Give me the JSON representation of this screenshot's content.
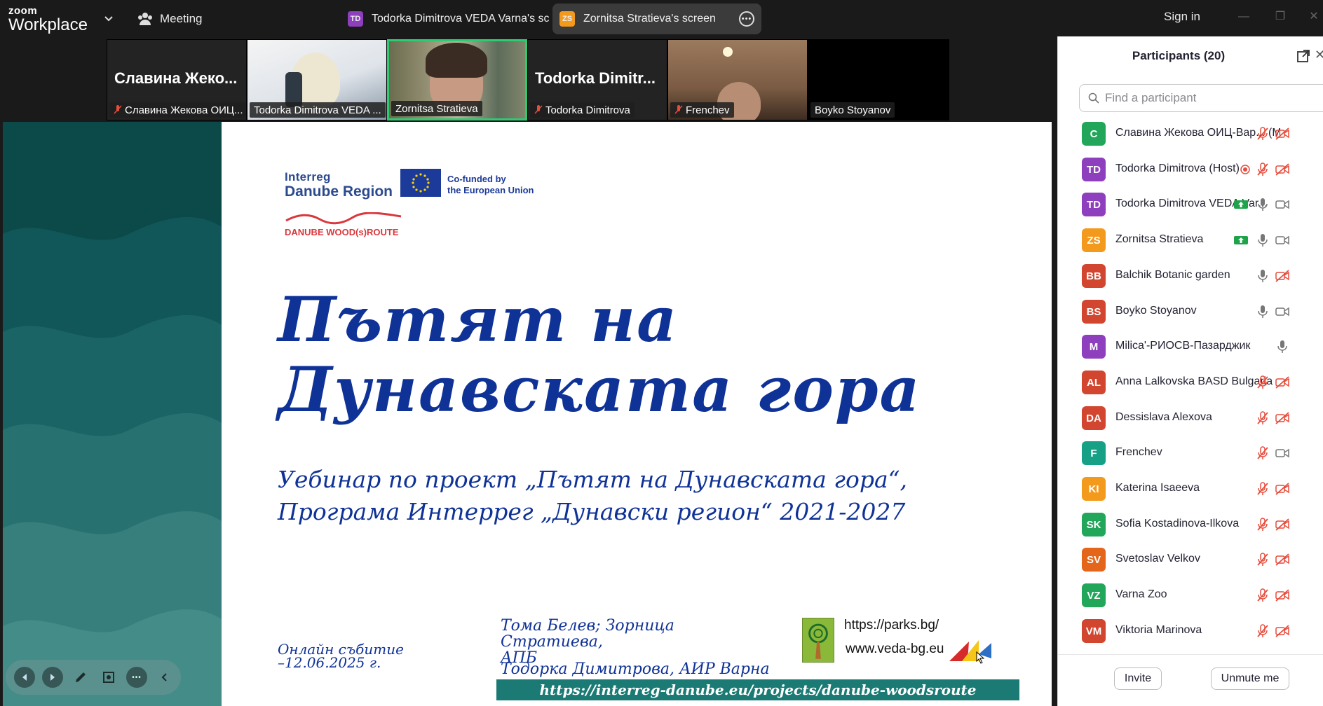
{
  "app": {
    "brand_small": "zoom",
    "brand_big": "Workplace"
  },
  "topbar": {
    "meeting_label": "Meeting",
    "share_tabs": [
      {
        "badge": "TD",
        "label": "Todorka Dimitrova VEDA Varna's scree"
      },
      {
        "badge": "ZS",
        "label": "Zornitsa Stratieva's screen"
      }
    ],
    "signin_label": "Sign in"
  },
  "filmstrip": [
    {
      "big_name": "Славина Жеко...",
      "label": "Славина Жекова ОИЦ..."
    },
    {
      "label": "Todorka Dimitrova VEDA ..."
    },
    {
      "label": "Zornitsa Stratieva"
    },
    {
      "big_name": "Todorka Dimitr...",
      "label": "Todorka Dimitrova"
    },
    {
      "label": "Frenchev"
    },
    {
      "label": "Boyko Stoyanov"
    }
  ],
  "slide": {
    "interreg_line1": "Interreg",
    "interreg_line2": "Danube Region",
    "cofunded_line1": "Co-funded by",
    "cofunded_line2": "the European Union",
    "wood_route": "DANUBE WOOD(s)ROUTE",
    "title_line1": "Пътят на",
    "title_line2": "Дунавската гора",
    "subtitle_line1": "Уебинар по проект „Пътят на Дунавската гора“,",
    "subtitle_line2": "Програма Интеррег „Дунавски регион“ 2021-2027",
    "event_line1": "Онлайн събитие",
    "event_line2": "–12.06.2025 г.",
    "authors_line1": "Тома Белев; Зорница Стратиева,",
    "authors_line2": "АПБ",
    "authors_line3": "Тодорка Димитрова, АИР Варна",
    "url_parks": "https://parks.bg/",
    "url_veda": "www.veda-bg.eu",
    "project_link": "https://interreg-danube.eu/projects/danube-woodsroute"
  },
  "panel": {
    "title": "Participants (20)",
    "search_placeholder": "Find a participant",
    "participants": [
      {
        "initials": "C",
        "color": "#22a65a",
        "name": "Славина Жекова ОИЦ-Вар... (Me)",
        "status": "muted"
      },
      {
        "initials": "TD",
        "color": "#8d3fbd",
        "name": "Todorka Dimitrova (Host)",
        "status": "muted",
        "recording": true
      },
      {
        "initials": "TD",
        "color": "#8d3fbd",
        "name": "Todorka Dimitrova VEDA Var...",
        "status": "mic",
        "sharing": true
      },
      {
        "initials": "ZS",
        "color": "#f39a1d",
        "name": "Zornitsa Stratieva",
        "status": "mic",
        "sharing": true
      },
      {
        "initials": "BB",
        "color": "#d2452f",
        "name": "Balchik Botanic garden",
        "status": "mic",
        "video_off": true
      },
      {
        "initials": "BS",
        "color": "#d2452f",
        "name": "Boyko Stoyanov",
        "status": "mic"
      },
      {
        "initials": "M",
        "color": "#8d3fbd",
        "name": "Milica'-РИОСВ-Пазарджик",
        "status": "mic-only"
      },
      {
        "initials": "AL",
        "color": "#d2452f",
        "name": "Anna Lalkovska  BASD Bulgaria",
        "status": "muted"
      },
      {
        "initials": "DA",
        "color": "#d2452f",
        "name": "Dessislava Alexova",
        "status": "muted"
      },
      {
        "initials": "F",
        "color": "#16a085",
        "name": "Frenchev",
        "status": "muted",
        "video_on": true
      },
      {
        "initials": "KI",
        "color": "#f39a1d",
        "name": "Katerina Isaeeva",
        "status": "muted"
      },
      {
        "initials": "SK",
        "color": "#22a65a",
        "name": "Sofia Kostadinova-Ilkova",
        "status": "muted"
      },
      {
        "initials": "SV",
        "color": "#e3661a",
        "name": "Svetoslav Velkov",
        "status": "muted"
      },
      {
        "initials": "VZ",
        "color": "#22a65a",
        "name": "Varna Zoo",
        "status": "muted"
      },
      {
        "initials": "VM",
        "color": "#d2452f",
        "name": "Viktoria Marinova",
        "status": "muted"
      }
    ],
    "invite_label": "Invite",
    "unmute_label": "Unmute me"
  }
}
